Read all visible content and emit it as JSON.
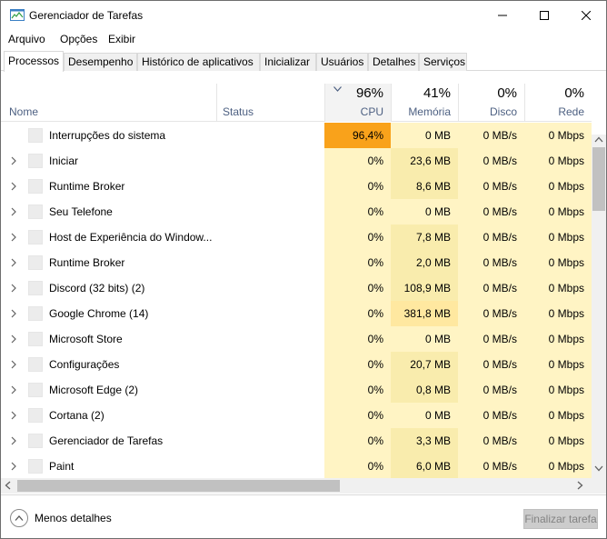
{
  "window": {
    "title": "Gerenciador de Tarefas"
  },
  "menu": [
    "Arquivo",
    "Opções",
    "Exibir"
  ],
  "tabs": [
    "Processos",
    "Desempenho",
    "Histórico de aplicativos",
    "Inicializar",
    "Usuários",
    "Detalhes",
    "Serviços"
  ],
  "active_tab": "Processos",
  "columns": {
    "name": "Nome",
    "status": "Status",
    "cpu": {
      "label": "CPU",
      "pct": "96%"
    },
    "memory": {
      "label": "Memória",
      "pct": "41%"
    },
    "disk": {
      "label": "Disco",
      "pct": "0%"
    },
    "network": {
      "label": "Rede",
      "pct": "0%"
    },
    "sorted_by": "CPU"
  },
  "processes": [
    {
      "name": "Interrupções do sistema",
      "expandable": false,
      "cpu": "96,4%",
      "memory": "0 MB",
      "disk": "0 MB/s",
      "network": "0 Mbps",
      "cpu_heat": "high",
      "mem_heat": "low"
    },
    {
      "name": "Iniciar",
      "expandable": true,
      "cpu": "0%",
      "memory": "23,6 MB",
      "disk": "0 MB/s",
      "network": "0 Mbps",
      "cpu_heat": "low",
      "mem_heat": "mid"
    },
    {
      "name": "Runtime Broker",
      "expandable": true,
      "cpu": "0%",
      "memory": "8,6 MB",
      "disk": "0 MB/s",
      "network": "0 Mbps",
      "cpu_heat": "low",
      "mem_heat": "mid"
    },
    {
      "name": "Seu Telefone",
      "expandable": true,
      "cpu": "0%",
      "memory": "0 MB",
      "disk": "0 MB/s",
      "network": "0 Mbps",
      "cpu_heat": "low",
      "mem_heat": "low"
    },
    {
      "name": "Host de Experiência do Window...",
      "expandable": true,
      "cpu": "0%",
      "memory": "7,8 MB",
      "disk": "0 MB/s",
      "network": "0 Mbps",
      "cpu_heat": "low",
      "mem_heat": "mid"
    },
    {
      "name": "Runtime Broker",
      "expandable": true,
      "cpu": "0%",
      "memory": "2,0 MB",
      "disk": "0 MB/s",
      "network": "0 Mbps",
      "cpu_heat": "low",
      "mem_heat": "mid"
    },
    {
      "name": "Discord (32 bits) (2)",
      "expandable": true,
      "cpu": "0%",
      "memory": "108,9 MB",
      "disk": "0 MB/s",
      "network": "0 Mbps",
      "cpu_heat": "low",
      "mem_heat": "mid"
    },
    {
      "name": "Google Chrome (14)",
      "expandable": true,
      "cpu": "0%",
      "memory": "381,8 MB",
      "disk": "0 MB/s",
      "network": "0 Mbps",
      "cpu_heat": "low",
      "mem_heat": "high"
    },
    {
      "name": "Microsoft Store",
      "expandable": true,
      "cpu": "0%",
      "memory": "0 MB",
      "disk": "0 MB/s",
      "network": "0 Mbps",
      "cpu_heat": "low",
      "mem_heat": "low"
    },
    {
      "name": "Configurações",
      "expandable": true,
      "cpu": "0%",
      "memory": "20,7 MB",
      "disk": "0 MB/s",
      "network": "0 Mbps",
      "cpu_heat": "low",
      "mem_heat": "mid"
    },
    {
      "name": "Microsoft Edge (2)",
      "expandable": true,
      "cpu": "0%",
      "memory": "0,8 MB",
      "disk": "0 MB/s",
      "network": "0 Mbps",
      "cpu_heat": "low",
      "mem_heat": "mid"
    },
    {
      "name": "Cortana (2)",
      "expandable": true,
      "cpu": "0%",
      "memory": "0 MB",
      "disk": "0 MB/s",
      "network": "0 Mbps",
      "cpu_heat": "low",
      "mem_heat": "low"
    },
    {
      "name": "Gerenciador de Tarefas",
      "expandable": true,
      "cpu": "0%",
      "memory": "3,3 MB",
      "disk": "0 MB/s",
      "network": "0 Mbps",
      "cpu_heat": "low",
      "mem_heat": "mid"
    },
    {
      "name": "Paint",
      "expandable": true,
      "cpu": "0%",
      "memory": "6,0 MB",
      "disk": "0 MB/s",
      "network": "0 Mbps",
      "cpu_heat": "low",
      "mem_heat": "mid"
    }
  ],
  "footer": {
    "less_details": "Menos detalhes",
    "end_task": "Finalizar tarefa"
  },
  "colors": {
    "heat_low": "#fff4c4",
    "heat_mid": "#f9ecad",
    "heat_high_mem": "#ffe8a0",
    "heat_high_cpu": "#f9a21b",
    "header_label": "#4d6082"
  },
  "icons": {
    "app": "task-manager-icon",
    "minimize": "minimize-icon",
    "maximize": "maximize-icon",
    "close": "close-icon",
    "expand": "chevron-right-icon",
    "sort": "chevron-down-icon",
    "less_details": "chevron-up-icon"
  }
}
